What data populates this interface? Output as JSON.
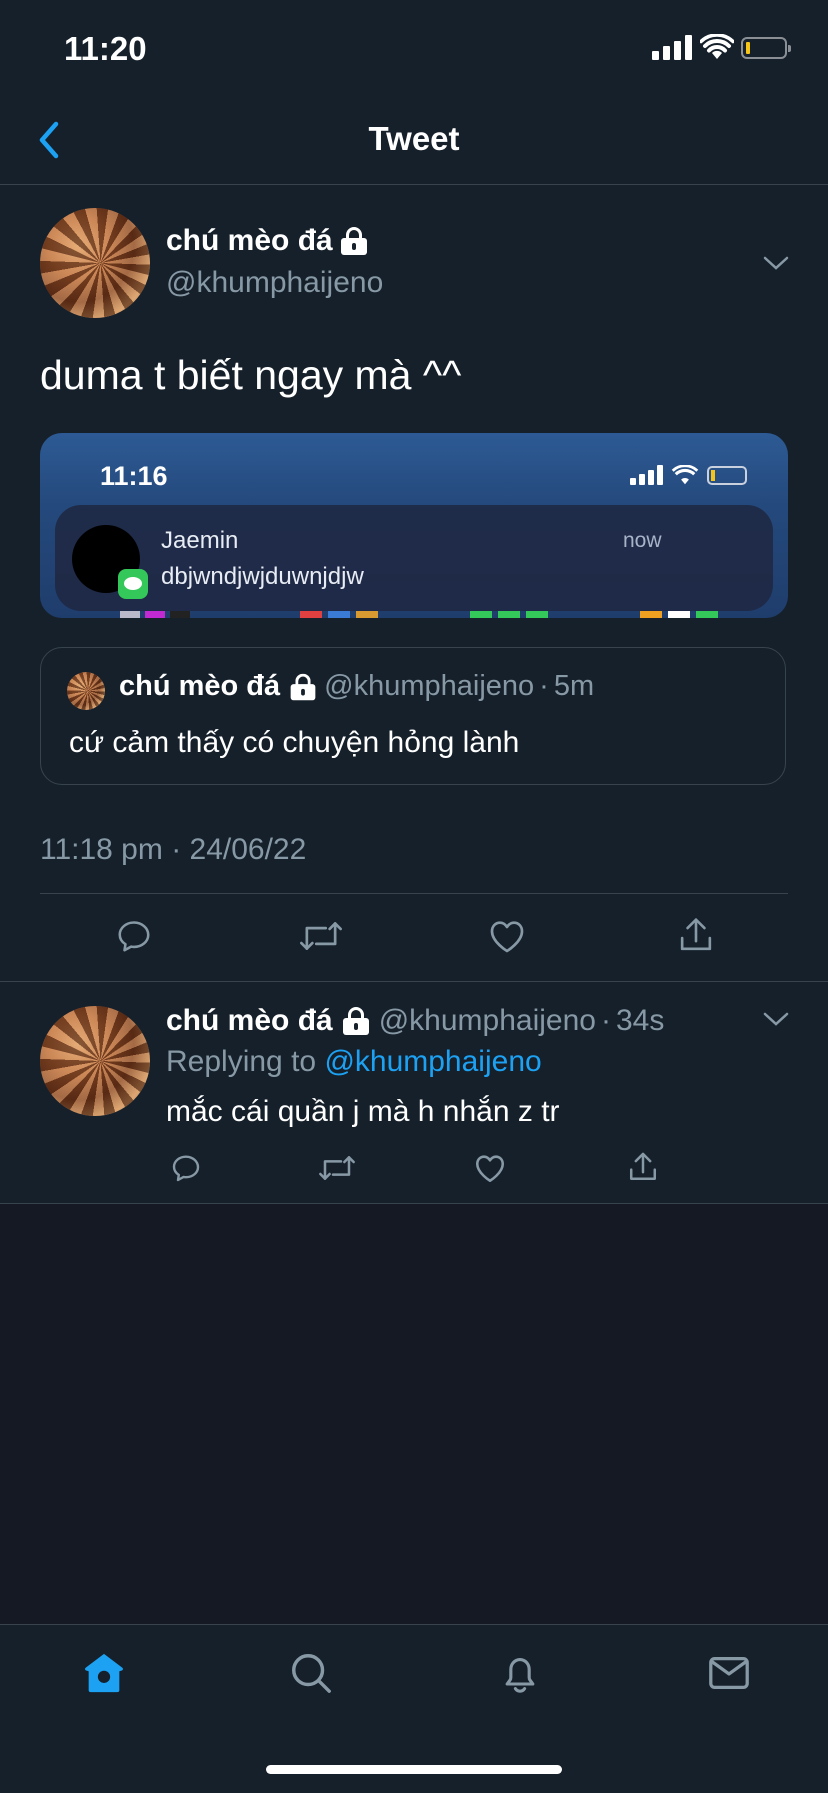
{
  "status_bar": {
    "time": "11:20"
  },
  "header": {
    "title": "Tweet"
  },
  "main_tweet": {
    "display_name": "chú mèo đá",
    "handle": "@khumphaijeno",
    "text": "duma t biết ngay mà ^^",
    "timestamp": "11:18 pm · 24/06/22",
    "media": {
      "time": "11:16",
      "notification": {
        "sender": "Jaemin",
        "message": "dbjwndjwjduwnjdjw",
        "when": "now"
      }
    },
    "quoted": {
      "display_name": "chú mèo đá",
      "handle": "@khumphaijeno",
      "age": "5m",
      "text": "cứ cảm thấy có chuyện hỏng lành"
    }
  },
  "reply": {
    "display_name": "chú mèo đá",
    "handle": "@khumphaijeno",
    "age": "34s",
    "replying_prefix": "Replying to",
    "replying_handle": "@khumphaijeno",
    "text": "mắc cái quần j mà h nhắn z tr"
  },
  "colors": {
    "background": "#15202b",
    "accent": "#1da1f2",
    "muted": "#8899a6",
    "divider": "#38444d"
  },
  "tabs": [
    {
      "name": "home",
      "icon": "home-icon",
      "active": true
    },
    {
      "name": "search",
      "icon": "search-icon",
      "active": false
    },
    {
      "name": "notifications",
      "icon": "bell-icon",
      "active": false
    },
    {
      "name": "messages",
      "icon": "mail-icon",
      "active": false
    }
  ]
}
